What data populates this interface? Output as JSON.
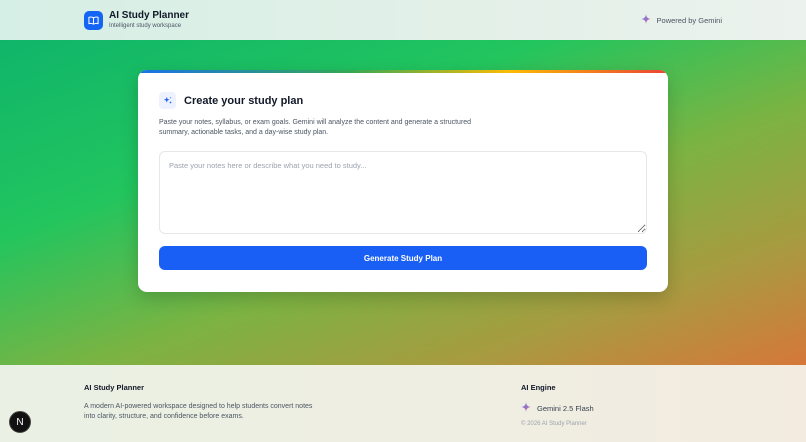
{
  "header": {
    "title": "AI Study Planner",
    "subtitle": "Intelligent study workspace",
    "powered_by": "Powered by Gemini"
  },
  "card": {
    "title": "Create your study plan",
    "description": "Paste your notes, syllabus, or exam goals. Gemini will analyze the content and generate a structured summary, actionable tasks, and a day-wise study plan.",
    "notes_placeholder": "Paste your notes here or describe what you need to study...",
    "notes_value": "",
    "button_label": "Generate Study Plan"
  },
  "footer": {
    "about_heading": "AI Study Planner",
    "about_text": "A modern AI-powered workspace designed to help students convert notes into clarity, structure, and confidence before exams.",
    "engine_heading": "AI Engine",
    "engine_name": "Gemini 2.5 Flash",
    "copyright": "© 2026 AI Study Planner"
  },
  "badge": {
    "letter": "N"
  },
  "icons": {
    "brand": "book-icon",
    "powered": "gemini-sparkle-icon",
    "card": "sparkles-icon",
    "engine": "gemini-sparkle-icon"
  },
  "colors": {
    "primary": "#1a5ff5",
    "hero_start": "#10b56a",
    "hero_end": "#d6773a"
  }
}
